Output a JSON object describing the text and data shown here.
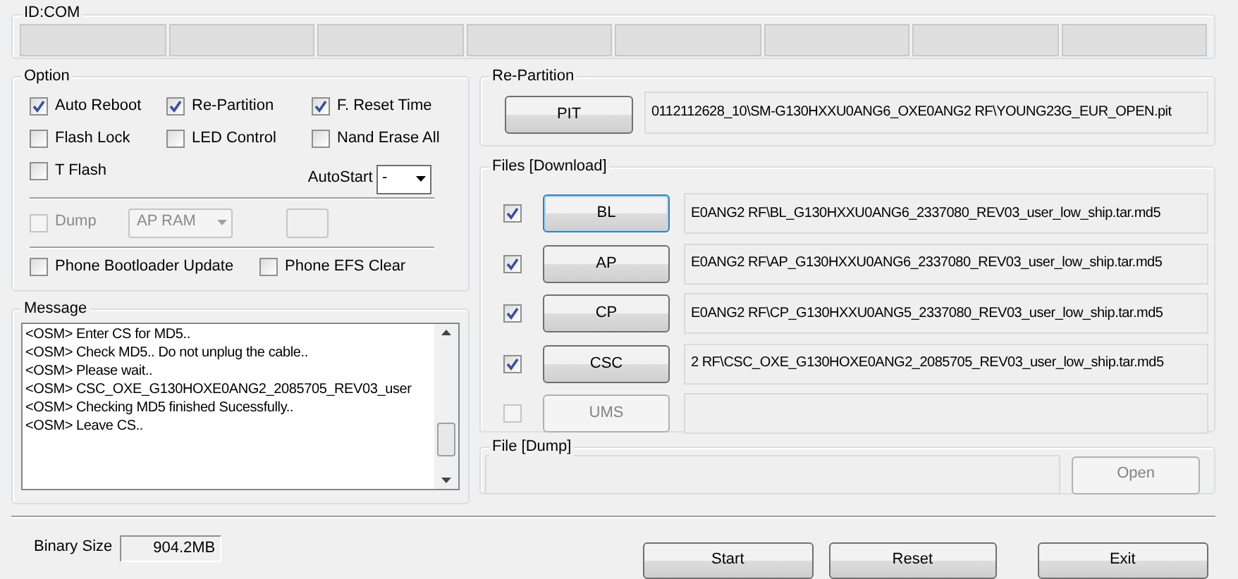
{
  "id_com": {
    "label": "ID:COM",
    "ports": [
      {
        "connected": false
      },
      {
        "connected": false
      },
      {
        "connected": false
      },
      {
        "connected": false
      },
      {
        "connected": false
      },
      {
        "connected": false
      },
      {
        "connected": false
      },
      {
        "connected": false
      }
    ]
  },
  "option": {
    "label": "Option",
    "checks": [
      {
        "label": "Auto Reboot",
        "checked": true
      },
      {
        "label": "Re-Partition",
        "checked": true
      },
      {
        "label": "F. Reset Time",
        "checked": true
      },
      {
        "label": "Flash Lock",
        "checked": false
      },
      {
        "label": "LED Control",
        "checked": false
      },
      {
        "label": "Nand Erase All",
        "checked": false
      },
      {
        "label": "T Flash",
        "checked": false
      }
    ],
    "autostart": {
      "label": "AutoStart",
      "value": "-"
    },
    "dump": {
      "label": "Dump",
      "checked": false,
      "disabled": true,
      "select": "AP RAM"
    },
    "bottom_checks": [
      {
        "label": "Phone Bootloader Update",
        "checked": false
      },
      {
        "label": "Phone EFS Clear",
        "checked": false
      }
    ]
  },
  "message": {
    "label": "Message",
    "lines": [
      "<OSM> Enter CS for MD5..",
      "<OSM> Check MD5.. Do not unplug the cable..",
      "<OSM> Please wait..",
      "<OSM> CSC_OXE_G130HOXE0ANG2_2085705_REV03_user",
      "<OSM> Checking MD5 finished Sucessfully..",
      "<OSM> Leave CS.."
    ]
  },
  "binary_size": {
    "label": "Binary Size",
    "value": "904.2MB"
  },
  "repartition": {
    "label": "Re-Partition",
    "button": "PIT",
    "path": "0112112628_10\\SM-G130HXXU0ANG6_OXE0ANG2 RF\\YOUNG23G_EUR_OPEN.pit"
  },
  "files": {
    "label": "Files [Download]",
    "rows": [
      {
        "button": "BL",
        "checked": true,
        "disabled": false,
        "focused": true,
        "path": "E0ANG2 RF\\BL_G130HXXU0ANG6_2337080_REV03_user_low_ship.tar.md5"
      },
      {
        "button": "AP",
        "checked": true,
        "disabled": false,
        "focused": false,
        "path": "E0ANG2 RF\\AP_G130HXXU0ANG6_2337080_REV03_user_low_ship.tar.md5"
      },
      {
        "button": "CP",
        "checked": true,
        "disabled": false,
        "focused": false,
        "path": "E0ANG2 RF\\CP_G130HXXU0ANG5_2337080_REV03_user_low_ship.tar.md5"
      },
      {
        "button": "CSC",
        "checked": true,
        "disabled": false,
        "focused": false,
        "path": "2 RF\\CSC_OXE_G130HOXE0ANG2_2085705_REV03_user_low_ship.tar.md5"
      },
      {
        "button": "UMS",
        "checked": false,
        "disabled": true,
        "focused": false
      }
    ]
  },
  "file_dump": {
    "label": "File [Dump]",
    "button": "Open",
    "disabled": true
  },
  "actions": [
    "Start",
    "Reset",
    "Exit"
  ]
}
